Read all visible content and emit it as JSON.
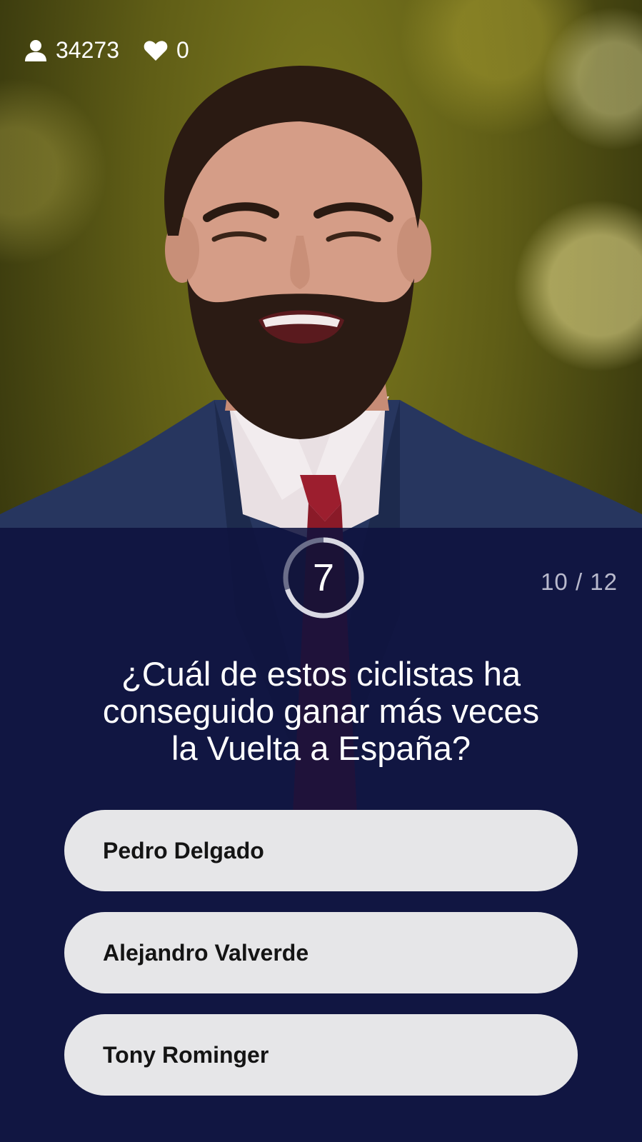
{
  "stats": {
    "viewers": "34273",
    "lives": "0",
    "viewer_icon": "person-icon",
    "lives_icon": "heart-icon"
  },
  "timer": {
    "seconds": "7",
    "remaining_fraction": 0.7
  },
  "progress": {
    "label": "10 / 12"
  },
  "question": {
    "line1": "¿Cuál de estos ciclistas ha",
    "line2": "conseguido ganar más veces",
    "line3": "la Vuelta a España?"
  },
  "answers": [
    {
      "label": "Pedro Delgado"
    },
    {
      "label": "Alejandro Valverde"
    },
    {
      "label": "Tony Rominger"
    }
  ],
  "colors": {
    "panel": "#0e123e",
    "answer_bg": "#e6e6e8",
    "text": "#ffffff"
  }
}
